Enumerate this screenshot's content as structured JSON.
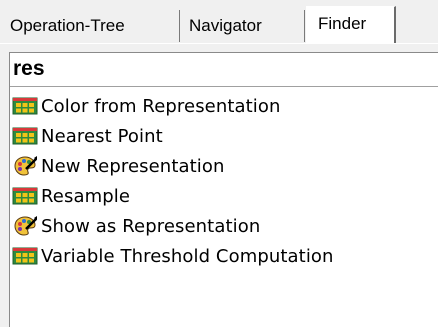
{
  "tabs": [
    {
      "label": "Operation-Tree",
      "active": false
    },
    {
      "label": "Navigator",
      "active": false
    },
    {
      "label": "Finder",
      "active": true
    }
  ],
  "search": {
    "value": "res"
  },
  "results": [
    {
      "label": "Color from Representation",
      "icon": "module-icon"
    },
    {
      "label": "Nearest Point",
      "icon": "module-icon"
    },
    {
      "label": "New Representation",
      "icon": "palette-icon"
    },
    {
      "label": "Resample",
      "icon": "module-icon"
    },
    {
      "label": "Show as Representation",
      "icon": "palette-icon"
    },
    {
      "label": "Variable Threshold Computation",
      "icon": "module-icon"
    }
  ],
  "colors": {
    "module_border": "#1f5f2a",
    "module_fill": "#2f8a3e",
    "module_cell": "#f2c418",
    "module_accent": "#d9383a"
  }
}
